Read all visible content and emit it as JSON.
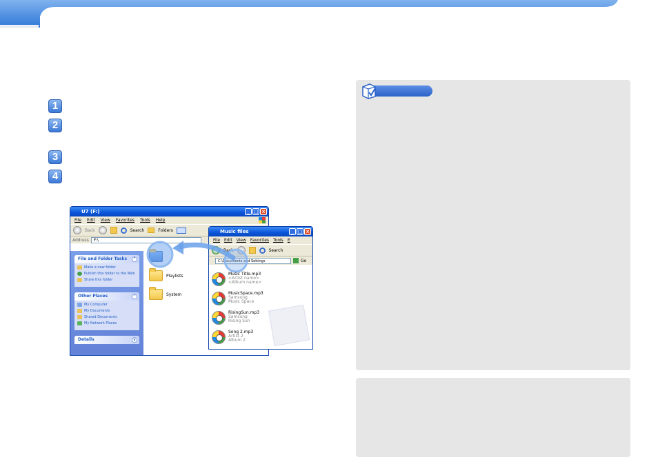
{
  "steps": [
    "1",
    "2",
    "3",
    "4"
  ],
  "window1": {
    "title": "U7 (F:)",
    "menu": [
      "File",
      "Edit",
      "View",
      "Favorites",
      "Tools",
      "Help"
    ],
    "toolbar": {
      "back": "Back",
      "search": "Search",
      "folders": "Folders"
    },
    "address_label": "Address",
    "address_value": "F:\\",
    "tasks_panel": {
      "title": "File and Folder Tasks",
      "items": [
        "Make a new folder",
        "Publish this folder to the Web",
        "Share this folder"
      ]
    },
    "other_places": {
      "title": "Other Places",
      "items": [
        "My Computer",
        "My Documents",
        "Shared Documents",
        "My Network Places"
      ]
    },
    "details_title": "Details",
    "folders": [
      "Playlists",
      "System"
    ]
  },
  "window2": {
    "title": "Music files",
    "menu": [
      "File",
      "Edit",
      "View",
      "Favorites",
      "Tools",
      "E"
    ],
    "toolbar": {
      "back": "Back",
      "search": "Search"
    },
    "address_value": "C:\\Documents and Settings",
    "go_label": "Go",
    "files": [
      {
        "name": "Music Title.mp3",
        "line2": "<Artist name>",
        "line3": "<Album name>"
      },
      {
        "name": "MusicSpace.mp3",
        "line2": "Samsung",
        "line3": "Music Space"
      },
      {
        "name": "RisingSun.mp3",
        "line2": "Samsung",
        "line3": "Rising Sun"
      },
      {
        "name": "Song 2.mp3",
        "line2": "Artist 2",
        "line3": "Album 2"
      }
    ]
  },
  "colors": {
    "accent": "#2b62c8",
    "note_bg": "#e6e6e6",
    "xp_title": "#0a55d8"
  }
}
